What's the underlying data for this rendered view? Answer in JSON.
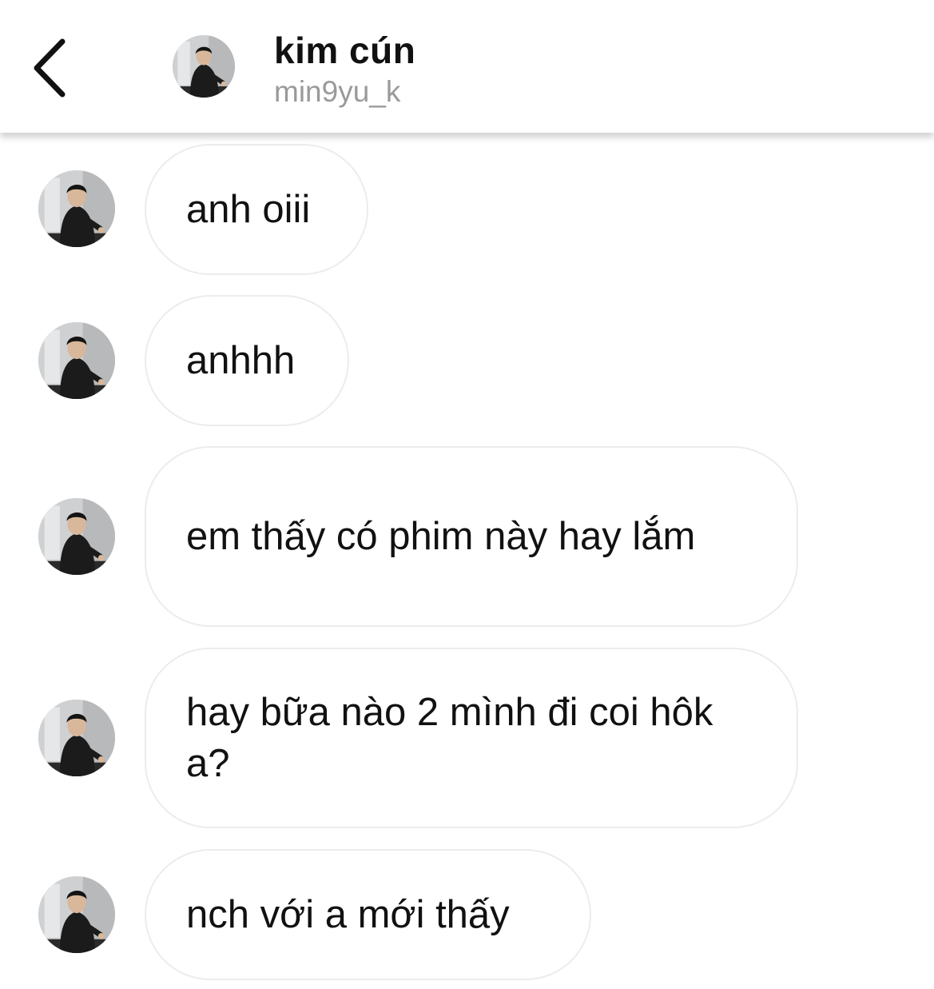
{
  "header": {
    "name": "kim cún",
    "username": "min9yu_k",
    "back_icon": "chevron-left-icon"
  },
  "messages": [
    {
      "text": "anh oiii"
    },
    {
      "text": "anhhh"
    },
    {
      "text": "em thấy có phim này hay lắm"
    },
    {
      "text": "hay bữa nào 2 mình đi coi hôk a?"
    },
    {
      "text": "nch với a mới thấy"
    }
  ],
  "colors": {
    "bubble_border": "#ececec",
    "username": "#9a9a9a",
    "text": "#111111"
  }
}
